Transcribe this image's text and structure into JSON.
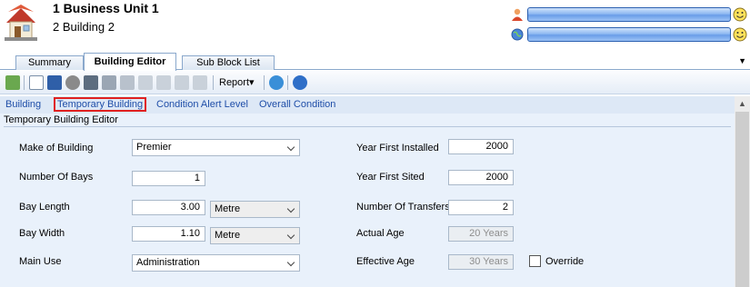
{
  "header": {
    "title": "1 Business Unit 1",
    "subtitle": "2 Building 2",
    "accent_bar_color": "#7aa9ec"
  },
  "tabs": [
    {
      "label": "Summary"
    },
    {
      "label": "Building Editor"
    },
    {
      "label": "Sub Block List"
    }
  ],
  "toolbar": {
    "report_label": "Report"
  },
  "subnav": {
    "items": [
      "Building",
      "Temporary Building",
      "Condition Alert Level",
      "Overall Condition"
    ],
    "highlight_color": "#e02020"
  },
  "panel": {
    "title": "Temporary Building Editor",
    "make_of_building": {
      "label": "Make of Building",
      "value": "Premier"
    },
    "number_of_bays": {
      "label": "Number Of Bays",
      "value": "1"
    },
    "bay_length": {
      "label": "Bay Length",
      "value": "3.00",
      "unit": "Metre"
    },
    "bay_width": {
      "label": "Bay Width",
      "value": "1.10",
      "unit": "Metre"
    },
    "main_use": {
      "label": "Main Use",
      "value": "Administration"
    },
    "year_first_installed": {
      "label": "Year First Installed",
      "value": "2000"
    },
    "year_first_sited": {
      "label": "Year First Sited",
      "value": "2000"
    },
    "number_of_transfers": {
      "label": "Number Of Transfers",
      "value": "2"
    },
    "actual_age": {
      "label": "Actual Age",
      "value": "20 Years"
    },
    "effective_age": {
      "label": "Effective Age",
      "value": "30 Years"
    },
    "override": {
      "label": "Override",
      "checked": false
    }
  }
}
